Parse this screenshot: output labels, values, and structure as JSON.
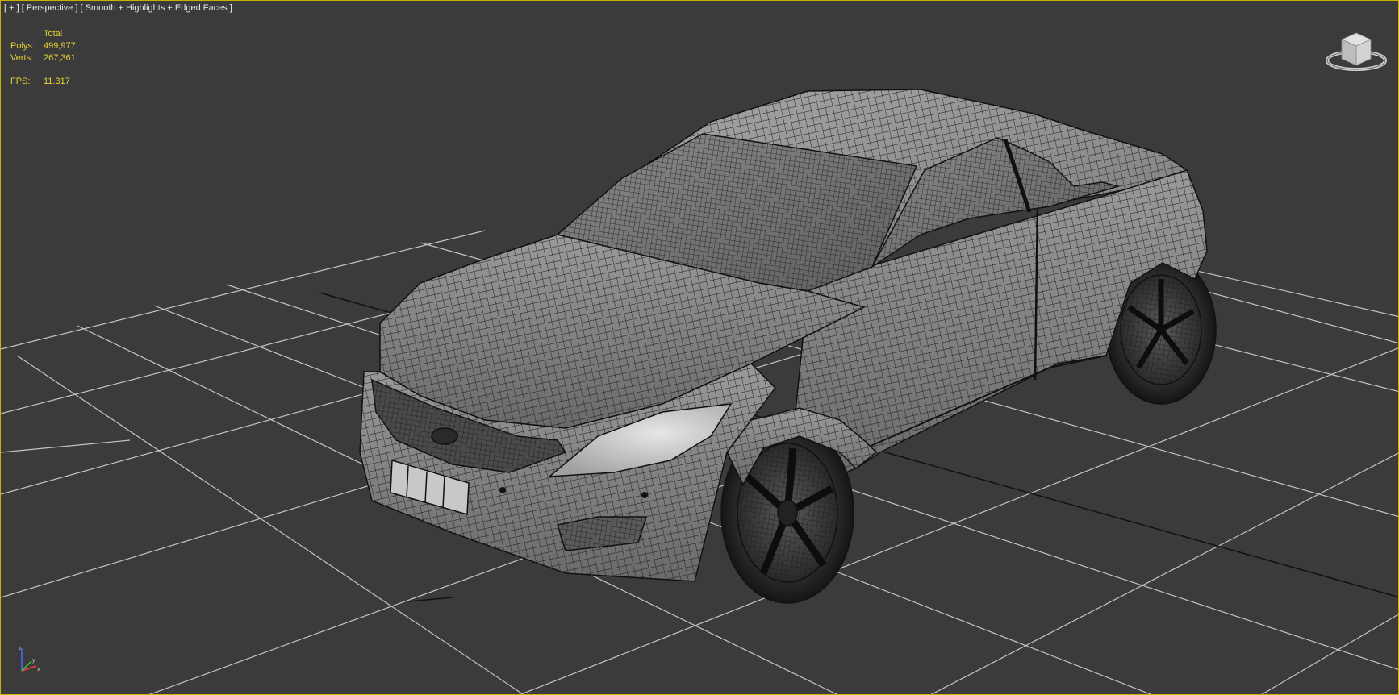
{
  "viewport": {
    "label_plus": "[ + ]",
    "label_view": "[ Perspective ]",
    "label_shading": "[ Smooth + Highlights + Edged Faces ]"
  },
  "stats": {
    "header": "Total",
    "polys_label": "Polys:",
    "polys_value": "499,977",
    "verts_label": "Verts:",
    "verts_value": "267,361",
    "fps_label": "FPS:",
    "fps_value": "11.317"
  },
  "viewcube": {
    "icon": "viewcube-icon"
  },
  "axis_tripod": {
    "icon": "axis-tripod-icon"
  },
  "colors": {
    "background": "#3b3b3b",
    "grid": "#c4c4c4",
    "grid_axis": "#111111",
    "stats_text": "#e8d234",
    "active_border": "#c8b400",
    "car_body": "#8a8a8a",
    "wire": "#1a1a1a"
  }
}
